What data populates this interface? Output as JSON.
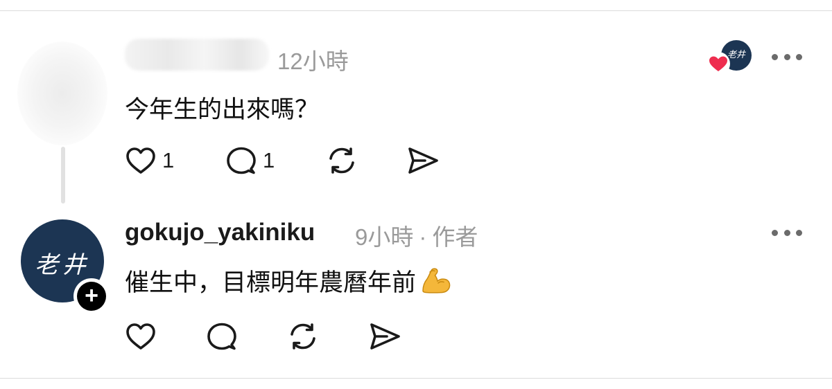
{
  "comment1": {
    "time": "12小時",
    "text": "今年生的出來嗎？",
    "like_count": "1",
    "reply_count": "1"
  },
  "comment2": {
    "username": "gokujo_yakiniku",
    "time": "9小時",
    "separator": "·",
    "author_tag": "作者",
    "text": "催生中，目標明年農曆年前",
    "emoji": "flexed-biceps-icon"
  },
  "brand_avatar": {
    "text": "老井"
  },
  "follow_badge": {
    "symbol": "+"
  },
  "colors": {
    "brand_navy": "#1c3553",
    "heart_red": "#ee2d4f",
    "meta_gray": "#9a9a9a",
    "icon_dark": "#1a1a1a"
  }
}
